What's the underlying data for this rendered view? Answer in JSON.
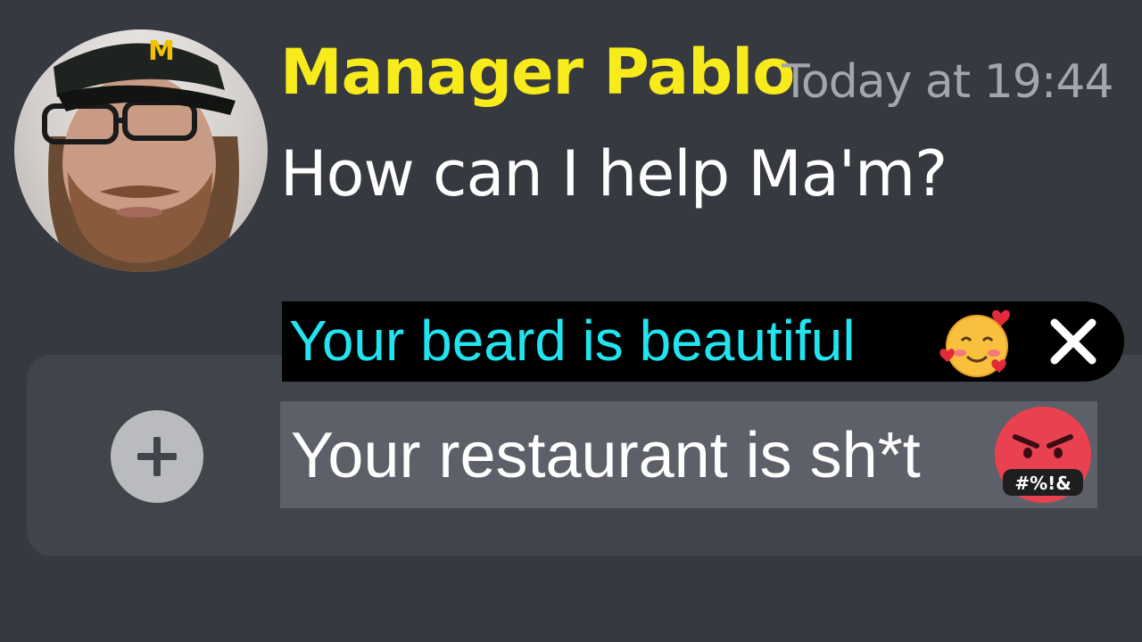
{
  "message": {
    "author": "Manager Pablo",
    "timestamp": "Today at 19:44",
    "text": "How can I help Ma'm?",
    "author_color": "#f7eb1c"
  },
  "avatar": {
    "cap_logo": "M"
  },
  "composer": {
    "attach_icon": "plus-icon",
    "suggestion": {
      "text": "Your beard is beautiful",
      "emoji": "smiling-face-with-hearts-emoji",
      "close_icon": "close-icon",
      "text_color": "#21e4ef"
    },
    "draft": {
      "text": "Your restaurant is sh*t",
      "emoji": "face-with-symbols-on-mouth-emoji",
      "emoji_symbols": "#%!&"
    }
  }
}
